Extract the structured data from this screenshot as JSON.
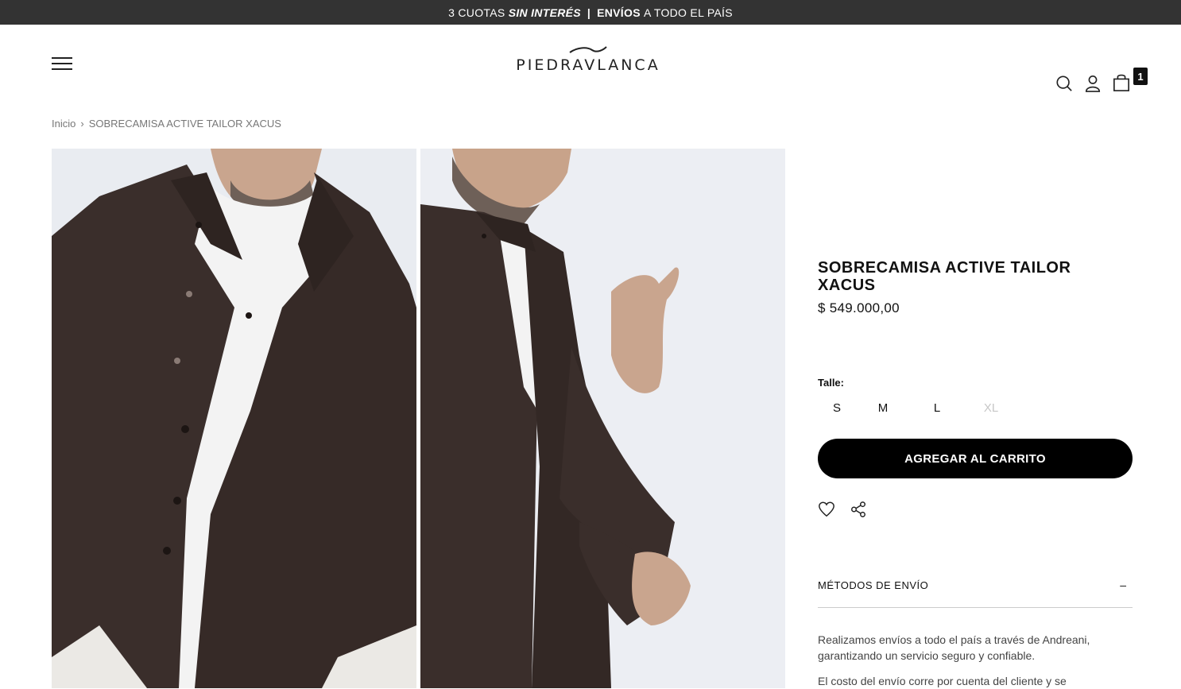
{
  "promo": {
    "part1": "3 CUOTAS",
    "part2": "SIN INTERÉS",
    "separator": "|",
    "part3": "ENVÍOS",
    "part4": "A TODO EL PAÍS"
  },
  "header": {
    "logo_text": "PIEDRAVLANCA",
    "cart_count": "1"
  },
  "breadcrumb": {
    "home": "Inicio",
    "separator": "›",
    "current": "SOBRECAMISA ACTIVE TAILOR XACUS"
  },
  "product": {
    "title_line1": "SOBRECAMISA ACTIVE TAILOR",
    "title_line2": "XACUS",
    "price": "$ 549.000,00",
    "size_label": "Talle:",
    "sizes": [
      {
        "label": "S",
        "available": true
      },
      {
        "label": "M",
        "available": true
      },
      {
        "label": "L",
        "available": true
      },
      {
        "label": "XL",
        "available": false
      }
    ],
    "add_to_cart": "AGREGAR AL CARRITO"
  },
  "shipping": {
    "title": "MÉTODOS DE ENVÍO",
    "toggle": "–",
    "text1": "Realizamos envíos a todo el país a través de Andreani, garantizando un servicio seguro y confiable.",
    "text2": "El costo del envío corre por cuenta del cliente y se"
  },
  "colors": {
    "promo_bg": "#333333",
    "shirt": "#3a2e2b",
    "photo_bg": "#e9ecf1",
    "button_bg": "#000000"
  }
}
